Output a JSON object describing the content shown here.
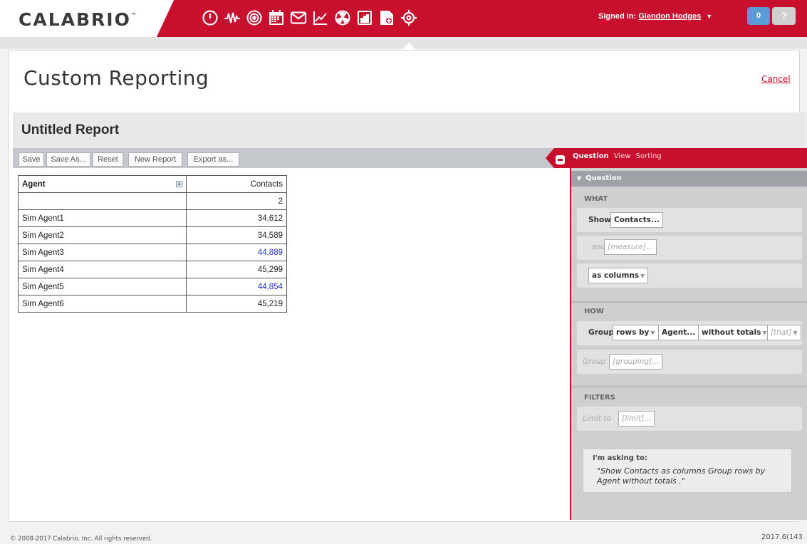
{
  "app": {
    "logo": "CALABRIO",
    "logo_tm": "™"
  },
  "nav_icons": [
    "power-icon",
    "waveform-icon",
    "target-icon",
    "calendar-icon",
    "mail-icon",
    "chart-icon",
    "radiation-icon",
    "report-icon",
    "custom-report-icon",
    "settings-gear-icon"
  ],
  "header": {
    "signed_in_label": "Signed in:",
    "user_name": "Glendon Hodges",
    "user_dropdown": "▼",
    "notification_count": "0",
    "help_label": "?"
  },
  "page": {
    "title": "Custom Reporting",
    "cancel_label": "Cancel"
  },
  "report": {
    "title": "Untitled Report"
  },
  "toolbar": {
    "save": "Save",
    "save_as": "Save As...",
    "reset": "Reset",
    "new_report": "New Report",
    "export_as": "Export as..."
  },
  "table": {
    "headers": {
      "agent": "Agent",
      "contacts": "Contacts"
    },
    "total": {
      "agent": "",
      "contacts": "2"
    },
    "rows": [
      {
        "agent": "Sim Agent1",
        "contacts": "34,612",
        "link": false
      },
      {
        "agent": "Sim Agent2",
        "contacts": "34,589",
        "link": false
      },
      {
        "agent": "Sim Agent3",
        "contacts": "44,889",
        "link": true
      },
      {
        "agent": "Sim Agent4",
        "contacts": "45,299",
        "link": false
      },
      {
        "agent": "Sim Agent5",
        "contacts": "44,854",
        "link": true
      },
      {
        "agent": "Sim Agent6",
        "contacts": "45,219",
        "link": false
      }
    ],
    "link_color": "#2233cc"
  },
  "panel": {
    "tabs": {
      "question": "Question",
      "view": "View",
      "sorting": "Sorting"
    },
    "question_header": "Question",
    "question_arrow": "▼",
    "what": {
      "label": "WHAT",
      "show_label": "Show",
      "show_value": "Contacts...",
      "and_label": "and",
      "and_placeholder": "[measure]...",
      "as_value": "as columns"
    },
    "how": {
      "label": "HOW",
      "group_label": "Group",
      "rows_by": "rows by",
      "agent": "Agent...",
      "totals": "without totals",
      "that_placeholder": "[that]",
      "group2_label": "Group",
      "grouping_placeholder": "[grouping]..."
    },
    "filters": {
      "label": "FILTERS",
      "limit_label": "Limit to",
      "limit_placeholder": "[limit]..."
    },
    "asking": {
      "label": "I'm asking to:",
      "text": "\"Show Contacts as columns Group rows by Agent without totals .\""
    }
  },
  "footer": {
    "copyright": "© 2008-2017 Calabrio, Inc. All rights reserved.",
    "version": "2017.6(143"
  },
  "colors": {
    "brand_red": "#c8102e",
    "notification_blue": "#5b9bd5"
  }
}
